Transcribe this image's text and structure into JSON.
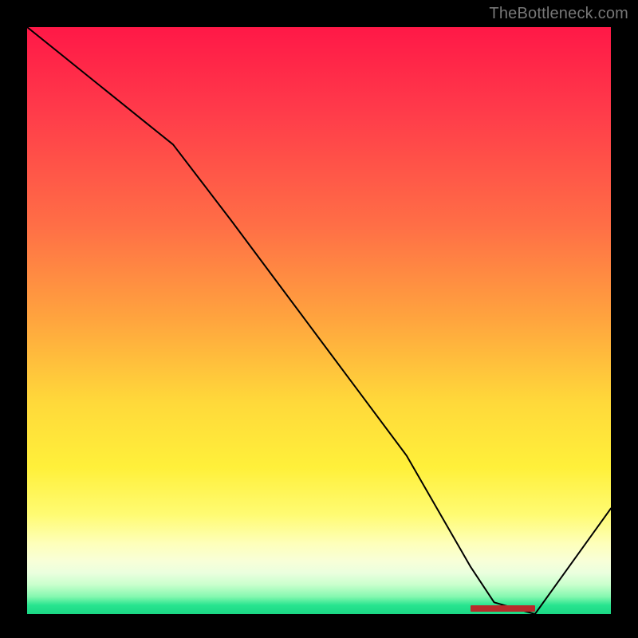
{
  "attribution": "TheBottleneck.com",
  "chart_data": {
    "type": "line",
    "title": "",
    "xlabel": "",
    "ylabel": "",
    "xlim": [
      0,
      100
    ],
    "ylim": [
      0,
      100
    ],
    "x": [
      0,
      10,
      20,
      25,
      35,
      50,
      65,
      76,
      80,
      87,
      100
    ],
    "values": [
      100,
      92,
      84,
      80,
      67,
      47,
      27,
      8,
      2,
      0,
      18
    ],
    "annotations": [
      {
        "kind": "valley-bar",
        "x_start": 76,
        "x_end": 87,
        "y": 0
      }
    ]
  }
}
